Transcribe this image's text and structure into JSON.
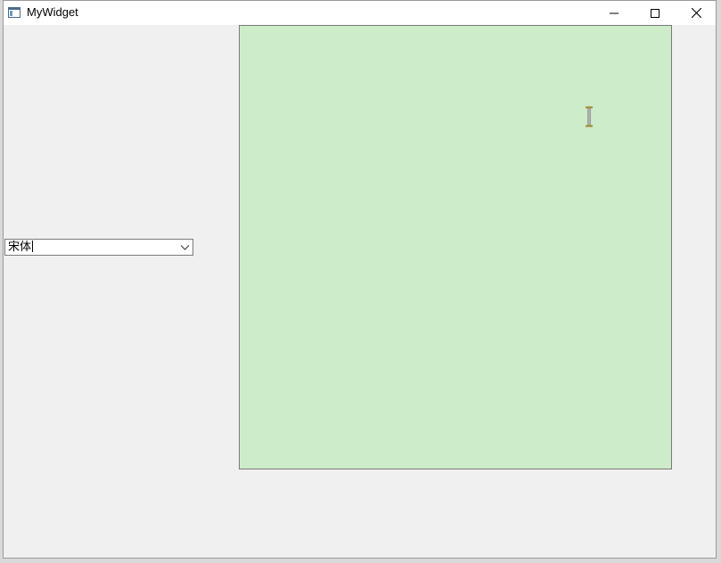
{
  "window": {
    "title": "MyWidget",
    "icon": "app-window-icon",
    "controls": [
      "minimize-icon",
      "maximize-icon",
      "close-icon"
    ]
  },
  "font_combo": {
    "value": "宋体",
    "icon": "chevron-down-icon"
  },
  "canvas": {
    "background": "#cdecca",
    "cursor": "text-cursor-icon"
  },
  "colors": {
    "window_bg": "#f0f0f0",
    "titlebar_bg": "#ffffff",
    "canvas_bg": "#cdecca",
    "border": "#7a7a7a"
  }
}
